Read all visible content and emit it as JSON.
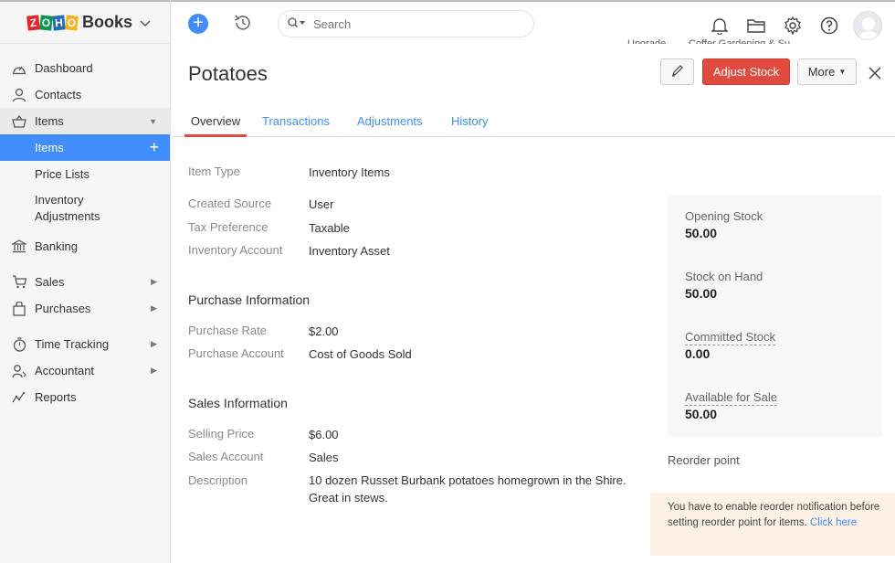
{
  "brand": {
    "logo_letters": [
      "Z",
      "O",
      "H",
      "O"
    ],
    "name": "Books"
  },
  "sidebar": {
    "items": [
      {
        "label": "Dashboard"
      },
      {
        "label": "Contacts"
      },
      {
        "label": "Items"
      },
      {
        "label": "Banking"
      },
      {
        "label": "Sales"
      },
      {
        "label": "Purchases"
      },
      {
        "label": "Time Tracking"
      },
      {
        "label": "Accountant"
      },
      {
        "label": "Reports"
      }
    ],
    "sub_items": [
      {
        "label": "Items",
        "add": "+"
      },
      {
        "label": "Price Lists"
      },
      {
        "label": "Inventory Adjustments"
      }
    ]
  },
  "topbar": {
    "search_placeholder": "Search",
    "peek_upgrade": "Upgrade",
    "peek_org": "Coffer Gardening & Su..."
  },
  "item": {
    "title": "Potatoes",
    "adjust_stock_label": "Adjust Stock",
    "more_label": "More"
  },
  "tabs": [
    {
      "label": "Overview",
      "active": true
    },
    {
      "label": "Transactions"
    },
    {
      "label": "Adjustments"
    },
    {
      "label": "History"
    }
  ],
  "details": {
    "item_type": {
      "label": "Item Type",
      "value": "Inventory Items"
    },
    "created_source": {
      "label": "Created Source",
      "value": "User"
    },
    "tax_preference": {
      "label": "Tax Preference",
      "value": "Taxable"
    },
    "inventory_account": {
      "label": "Inventory Account",
      "value": "Inventory Asset"
    }
  },
  "purchase": {
    "title": "Purchase Information",
    "rate": {
      "label": "Purchase Rate",
      "value": "$2.00"
    },
    "account": {
      "label": "Purchase Account",
      "value": "Cost of Goods Sold"
    }
  },
  "sales": {
    "title": "Sales Information",
    "price": {
      "label": "Selling Price",
      "value": "$6.00"
    },
    "account": {
      "label": "Sales Account",
      "value": "Sales"
    },
    "description": {
      "label": "Description",
      "value": "10 dozen Russet Burbank potatoes homegrown in the Shire. Great in stews."
    }
  },
  "stock": {
    "opening": {
      "label": "Opening Stock",
      "value": "50.00"
    },
    "on_hand": {
      "label": "Stock on Hand",
      "value": "50.00"
    },
    "committed": {
      "label": "Committed Stock",
      "value": "0.00"
    },
    "available": {
      "label": "Available for Sale",
      "value": "50.00"
    }
  },
  "reorder": {
    "label": "Reorder point",
    "note": "You have to enable reorder notification before setting reorder point for items.",
    "link": "Click here"
  },
  "colors": {
    "accent": "#408dfb",
    "danger": "#e04a3f",
    "note_bg": "#fdf1e5"
  }
}
